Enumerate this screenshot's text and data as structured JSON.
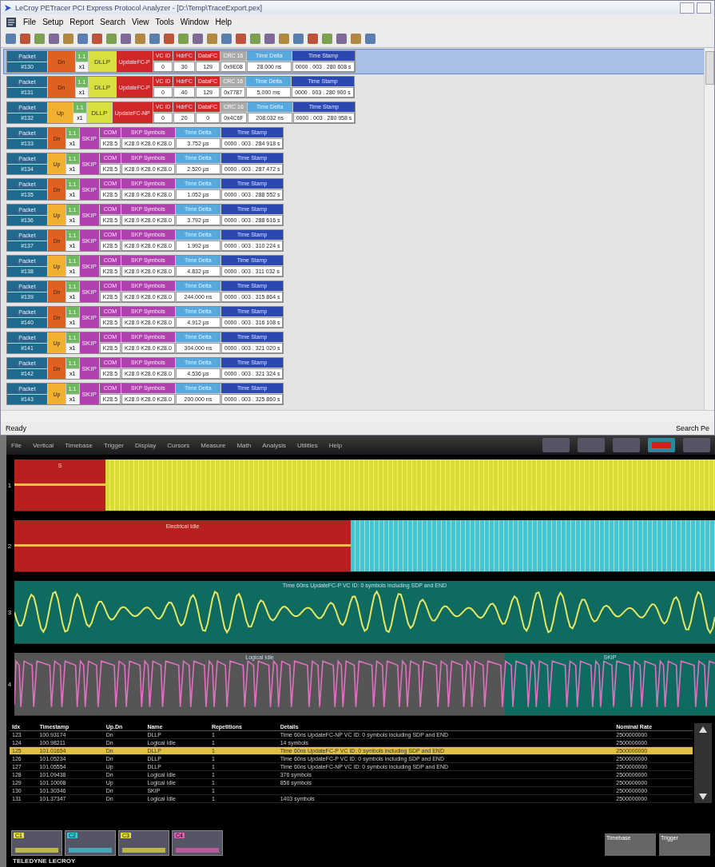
{
  "window": {
    "title": "LeCroy PETracer PCI Express Protocol Analyzer - [D:\\Temp\\TraceExport.pex]"
  },
  "menu": [
    "File",
    "Setup",
    "Report",
    "Search",
    "View",
    "Tools",
    "Window",
    "Help"
  ],
  "packets": [
    {
      "kind": "dllp",
      "selected": true,
      "label": "Packet",
      "number": "#130",
      "upstream": false,
      "dir_label": "Dn",
      "lane": "1.1",
      "width": "x1",
      "type": "DLLP",
      "subtype": "UpdateFC-P",
      "fields": [
        {
          "kind": "flow",
          "header": "VC ID",
          "value": "0"
        },
        {
          "kind": "flow",
          "header": "HdrFC",
          "value": "30"
        },
        {
          "kind": "flow",
          "header": "DataFC",
          "value": "129"
        },
        {
          "kind": "crc",
          "header": "CRC 16",
          "value": "0x9E08"
        },
        {
          "kind": "delta",
          "header": "Time Delta",
          "value": "28.000 ns"
        },
        {
          "kind": "stamp",
          "header": "Time Stamp",
          "value": "0000 . 003 . 280 608 s"
        }
      ]
    },
    {
      "kind": "dllp",
      "selected": false,
      "label": "Packet",
      "number": "#131",
      "upstream": false,
      "dir_label": "Dn",
      "lane": "1.1",
      "width": "x1",
      "type": "DLLP",
      "subtype": "UpdateFC-P",
      "fields": [
        {
          "kind": "flow",
          "header": "VC ID",
          "value": "0"
        },
        {
          "kind": "flow",
          "header": "HdrFC",
          "value": "40"
        },
        {
          "kind": "flow",
          "header": "DataFC",
          "value": "129"
        },
        {
          "kind": "crc",
          "header": "CRC 16",
          "value": "0x7787"
        },
        {
          "kind": "delta",
          "header": "Time Delta",
          "value": "5.000 ms"
        },
        {
          "kind": "stamp",
          "header": "Time Stamp",
          "value": "0000 . 003 . 280 900 s"
        }
      ]
    },
    {
      "kind": "dllp",
      "selected": false,
      "label": "Packet",
      "number": "#132",
      "upstream": true,
      "dir_label": "Up",
      "lane": "1.1",
      "width": "x1",
      "type": "DLLP",
      "subtype": "UpdateFC-NP",
      "fields": [
        {
          "kind": "flow",
          "header": "VC ID",
          "value": "0"
        },
        {
          "kind": "flow",
          "header": "HdrFC",
          "value": "20"
        },
        {
          "kind": "flow",
          "header": "DataFC",
          "value": "0"
        },
        {
          "kind": "crc",
          "header": "CRC 16",
          "value": "0x4C6F"
        },
        {
          "kind": "delta",
          "header": "Time Delta",
          "value": "208.032 ns"
        },
        {
          "kind": "stamp",
          "header": "Time Stamp",
          "value": "0000 . 003 . 280 958 s"
        }
      ]
    },
    {
      "kind": "skip",
      "selected": false,
      "label": "Packet",
      "number": "#133",
      "upstream": false,
      "dir_label": "Dn",
      "lane": "1.1",
      "width": "x1",
      "type": "SKIP",
      "fields": [
        {
          "kind": "skp",
          "header": "COM",
          "value": "K28.5"
        },
        {
          "kind": "skp",
          "header": "SKP Symbols",
          "value": "K28.0 K28.0 K28.0"
        },
        {
          "kind": "delta",
          "header": "Time Delta",
          "value": "3.752 µs"
        },
        {
          "kind": "stamp",
          "header": "Time Stamp",
          "value": "0000 . 003 . 284 918 s"
        }
      ]
    },
    {
      "kind": "skip",
      "selected": false,
      "label": "Packet",
      "number": "#134",
      "upstream": true,
      "dir_label": "Up",
      "lane": "1.1",
      "width": "x1",
      "type": "SKIP",
      "fields": [
        {
          "kind": "skp",
          "header": "COM",
          "value": "K28.5"
        },
        {
          "kind": "skp",
          "header": "SKP Symbols",
          "value": "K28.0 K28.0 K28.0"
        },
        {
          "kind": "delta",
          "header": "Time Delta",
          "value": "2.520 µs"
        },
        {
          "kind": "stamp",
          "header": "Time Stamp",
          "value": "0000 . 003 . 287 472 s"
        }
      ]
    },
    {
      "kind": "skip",
      "selected": false,
      "label": "Packet",
      "number": "#135",
      "upstream": false,
      "dir_label": "Dn",
      "lane": "1.1",
      "width": "x1",
      "type": "SKIP",
      "fields": [
        {
          "kind": "skp",
          "header": "COM",
          "value": "K28.5"
        },
        {
          "kind": "skp",
          "header": "SKP Symbols",
          "value": "K28.0 K28.0 K28.0"
        },
        {
          "kind": "delta",
          "header": "Time Delta",
          "value": "1.052 µs"
        },
        {
          "kind": "stamp",
          "header": "Time Stamp",
          "value": "0000 . 003 . 288 552 s"
        }
      ]
    },
    {
      "kind": "skip",
      "selected": false,
      "label": "Packet",
      "number": "#136",
      "upstream": true,
      "dir_label": "Up",
      "lane": "1.1",
      "width": "x1",
      "type": "SKIP",
      "fields": [
        {
          "kind": "skp",
          "header": "COM",
          "value": "K28.5"
        },
        {
          "kind": "skp",
          "header": "SKP Symbols",
          "value": "K28.0 K28.0 K28.0"
        },
        {
          "kind": "delta",
          "header": "Time Delta",
          "value": "3.792 µs"
        },
        {
          "kind": "stamp",
          "header": "Time Stamp",
          "value": "0000 . 003 . 288 616 s"
        }
      ]
    },
    {
      "kind": "skip",
      "selected": false,
      "label": "Packet",
      "number": "#137",
      "upstream": false,
      "dir_label": "Dn",
      "lane": "1.1",
      "width": "x1",
      "type": "SKIP",
      "fields": [
        {
          "kind": "skp",
          "header": "COM",
          "value": "K28.5"
        },
        {
          "kind": "skp",
          "header": "SKP Symbols",
          "value": "K28.0 K28.0 K28.0"
        },
        {
          "kind": "delta",
          "header": "Time Delta",
          "value": "1.992 µs"
        },
        {
          "kind": "stamp",
          "header": "Time Stamp",
          "value": "0000 . 003 . 310 224 s"
        }
      ]
    },
    {
      "kind": "skip",
      "selected": false,
      "label": "Packet",
      "number": "#138",
      "upstream": true,
      "dir_label": "Up",
      "lane": "1.1",
      "width": "x1",
      "type": "SKIP",
      "fields": [
        {
          "kind": "skp",
          "header": "COM",
          "value": "K28.5"
        },
        {
          "kind": "skp",
          "header": "SKP Symbols",
          "value": "K28.0 K28.0 K28.0"
        },
        {
          "kind": "delta",
          "header": "Time Delta",
          "value": "4.832 µs"
        },
        {
          "kind": "stamp",
          "header": "Time Stamp",
          "value": "0000 . 003 . 311 032 s"
        }
      ]
    },
    {
      "kind": "skip",
      "selected": false,
      "label": "Packet",
      "number": "#139",
      "upstream": false,
      "dir_label": "Dn",
      "lane": "1.1",
      "width": "x1",
      "type": "SKIP",
      "fields": [
        {
          "kind": "skp",
          "header": "COM",
          "value": "K28.5"
        },
        {
          "kind": "skp",
          "header": "SKP Symbols",
          "value": "K28.0 K28.0 K28.0"
        },
        {
          "kind": "delta",
          "header": "Time Delta",
          "value": "244.000 ns"
        },
        {
          "kind": "stamp",
          "header": "Time Stamp",
          "value": "0000 . 003 . 315 864 s"
        }
      ]
    },
    {
      "kind": "skip",
      "selected": false,
      "label": "Packet",
      "number": "#140",
      "upstream": false,
      "dir_label": "Dn",
      "lane": "1.1",
      "width": "x1",
      "type": "SKIP",
      "fields": [
        {
          "kind": "skp",
          "header": "COM",
          "value": "K28.5"
        },
        {
          "kind": "skp",
          "header": "SKP Symbols",
          "value": "K28.0 K28.0 K28.0"
        },
        {
          "kind": "delta",
          "header": "Time Delta",
          "value": "4.912 µs"
        },
        {
          "kind": "stamp",
          "header": "Time Stamp",
          "value": "0000 . 003 . 316 108 s"
        }
      ]
    },
    {
      "kind": "skip",
      "selected": false,
      "label": "Packet",
      "number": "#141",
      "upstream": true,
      "dir_label": "Up",
      "lane": "1.1",
      "width": "x1",
      "type": "SKIP",
      "fields": [
        {
          "kind": "skp",
          "header": "COM",
          "value": "K28.5"
        },
        {
          "kind": "skp",
          "header": "SKP Symbols",
          "value": "K28.0 K28.0 K28.0"
        },
        {
          "kind": "delta",
          "header": "Time Delta",
          "value": "304.000 ns"
        },
        {
          "kind": "stamp",
          "header": "Time Stamp",
          "value": "0000 . 003 . 321 020 s"
        }
      ]
    },
    {
      "kind": "skip",
      "selected": false,
      "label": "Packet",
      "number": "#142",
      "upstream": false,
      "dir_label": "Dn",
      "lane": "1.1",
      "width": "x1",
      "type": "SKIP",
      "fields": [
        {
          "kind": "skp",
          "header": "COM",
          "value": "K28.5"
        },
        {
          "kind": "skp",
          "header": "SKP Symbols",
          "value": "K28.0 K28.0 K28.0"
        },
        {
          "kind": "delta",
          "header": "Time Delta",
          "value": "4.536 µs"
        },
        {
          "kind": "stamp",
          "header": "Time Stamp",
          "value": "0000 . 003 . 321 324 s"
        }
      ]
    },
    {
      "kind": "skip",
      "selected": false,
      "label": "Packet",
      "number": "#143",
      "upstream": true,
      "dir_label": "Up",
      "lane": "1.1",
      "width": "x1",
      "type": "SKIP",
      "fields": [
        {
          "kind": "skp",
          "header": "COM",
          "value": "K28.5"
        },
        {
          "kind": "skp",
          "header": "SKP Symbols",
          "value": "K28.0 K28.0 K28.0"
        },
        {
          "kind": "delta",
          "header": "Time Delta",
          "value": "200.000 ns"
        },
        {
          "kind": "stamp",
          "header": "Time Stamp",
          "value": "0000 . 003 . 325 860 s"
        }
      ]
    }
  ],
  "status_bar": {
    "left": "Ready",
    "right": "Search Pe"
  },
  "scope": {
    "menu": [
      "File",
      "Vertical",
      "Timebase",
      "Trigger",
      "Display",
      "Cursors",
      "Measure",
      "Math",
      "Analysis",
      "Utilities",
      "Help"
    ],
    "traces": [
      {
        "kind": "bus",
        "channel": "1",
        "color": "#dada3a",
        "idle_label": "S"
      },
      {
        "kind": "bus",
        "channel": "2",
        "color": "#3cc8d8",
        "idle_label": "Electrical Idle"
      },
      {
        "kind": "analog",
        "channel": "3",
        "color": "#e8e860",
        "annotation": "Time 60ns UpdateFC-P VC ID: 0 symbols including SDP and END"
      },
      {
        "kind": "digital",
        "channel": "4",
        "color": "#e070c0",
        "annotation": "Logical Idle",
        "annotation2": "SKIP"
      }
    ],
    "table": {
      "columns": [
        "Idx",
        "Timestamp",
        "Up.Dn",
        "Name",
        "Repetitions",
        "Details",
        "Nominal Rate"
      ],
      "rows": [
        {
          "selected": false,
          "cells": [
            "123",
            "100.93174",
            "Dn",
            "DLLP",
            "1",
            "Time 60ns UpdateFC-NP VC ID: 0 symbols including SDP and END",
            "2500000000"
          ]
        },
        {
          "selected": false,
          "cells": [
            "124",
            "100.98211",
            "Dn",
            "Logical Idle",
            "1",
            "14 symbols",
            "2500000000"
          ]
        },
        {
          "selected": true,
          "cells": [
            "125",
            "101.01654",
            "Dn",
            "DLLP",
            "1",
            "Time 60ns UpdateFC-P VC ID: 0 symbols including SDP and END",
            "2500000000"
          ]
        },
        {
          "selected": false,
          "cells": [
            "126",
            "101.05234",
            "Dn",
            "DLLP",
            "1",
            "Time 60ns UpdateFC-P VC ID: 0 symbols including SDP and END",
            "2500000000"
          ]
        },
        {
          "selected": false,
          "cells": [
            "127",
            "101.05554",
            "Up",
            "DLLP",
            "1",
            "Time 60ns UpdateFC-NP VC ID: 0 symbols including SDP and END",
            "2500000000"
          ]
        },
        {
          "selected": false,
          "cells": [
            "128",
            "101.09438",
            "Dn",
            "Logical Idle",
            "1",
            "376 symbols",
            "2500000000"
          ]
        },
        {
          "selected": false,
          "cells": [
            "129",
            "101.10008",
            "Up",
            "Logical Idle",
            "1",
            "856 symbols",
            "2500000000"
          ]
        },
        {
          "selected": false,
          "cells": [
            "130",
            "101.30346",
            "Dn",
            "SKIP",
            "1",
            "",
            "2500000000"
          ]
        },
        {
          "selected": false,
          "cells": [
            "131",
            "101.37347",
            "Dn",
            "Logical Idle",
            "1",
            "1403 symbols",
            "2500000000"
          ]
        }
      ]
    },
    "channels": [
      {
        "label": "C1",
        "color": "#e8e040"
      },
      {
        "label": "C2",
        "color": "#40c8d8"
      },
      {
        "label": "C3",
        "color": "#e8e040"
      },
      {
        "label": "C4",
        "color": "#e060b0"
      }
    ],
    "timebase": "Timebase",
    "trigger": "Trigger",
    "brand": "TELEDYNE LECROY"
  }
}
